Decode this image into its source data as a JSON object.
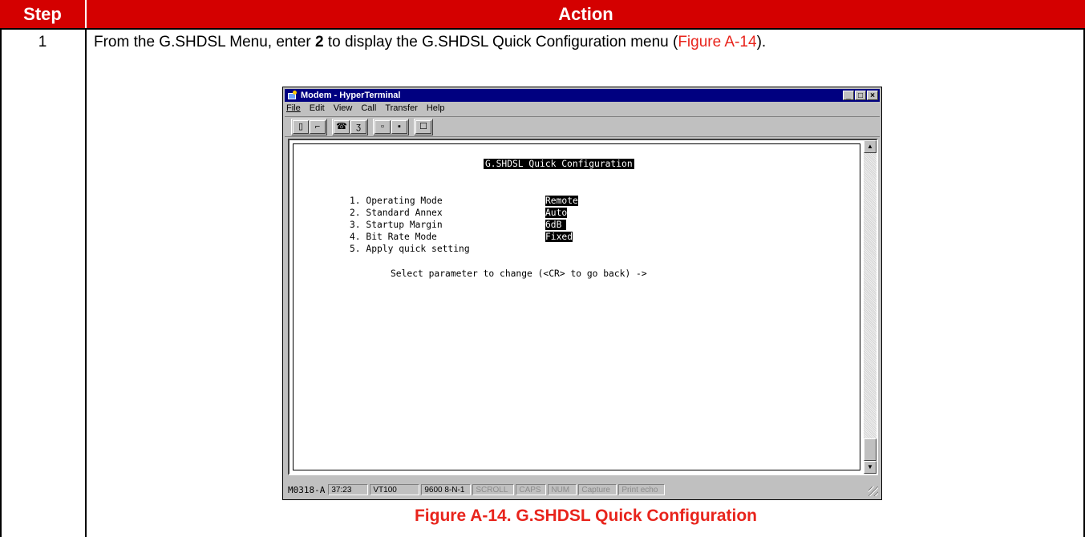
{
  "table": {
    "header_step": "Step",
    "header_action": "Action",
    "step_number": "1",
    "instruction": {
      "pre": "From the G.SHDSL Menu, enter ",
      "bold": "2",
      "mid": " to display the G.SHDSL Quick Configuration menu (",
      "ref": "Figure A-14",
      "post": ")."
    },
    "caption": "Figure A-14. G.SHDSL Quick Configuration"
  },
  "window": {
    "title": "Modem - HyperTerminal",
    "menu": [
      "File",
      "Edit",
      "View",
      "Call",
      "Transfer",
      "Help"
    ],
    "terminal": {
      "title": "G.SHDSL Quick Configuration",
      "items": [
        {
          "label": "1. Operating Mode",
          "value": "Remote"
        },
        {
          "label": "2. Standard Annex",
          "value": "Auto"
        },
        {
          "label": "3. Startup Margin",
          "value": "6dB"
        },
        {
          "label": "4. Bit Rate Mode",
          "value": "Fixed"
        },
        {
          "label": "5. Apply quick setting",
          "value": ""
        }
      ],
      "prompt": "Select parameter to change (<CR> to go back) ->"
    },
    "status": {
      "model": "M0318-A",
      "time": "37:23",
      "emulation": "VT100",
      "port": "9600 8-N-1",
      "scroll": "SCROLL",
      "caps": "CAPS",
      "num": "NUM",
      "capture": "Capture",
      "print_echo": "Print echo"
    }
  }
}
